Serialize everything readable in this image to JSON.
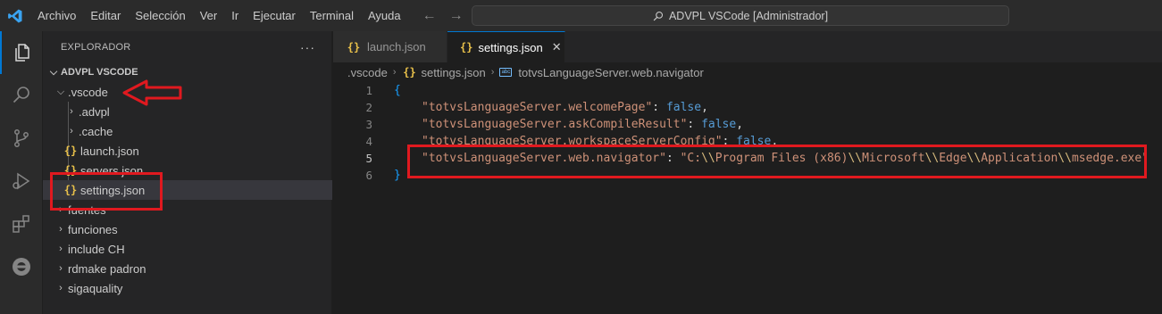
{
  "menu": [
    "Archivo",
    "Editar",
    "Selección",
    "Ver",
    "Ir",
    "Ejecutar",
    "Terminal",
    "Ayuda"
  ],
  "command_center": "ADVPL VSCode [Administrador]",
  "colors": {
    "accent": "#0078d4",
    "annotation": "#e0191f"
  },
  "sidebar": {
    "title": "EXPLORADOR",
    "more": "···",
    "tree": [
      {
        "label": "ADVPL VSCODE",
        "type": "root",
        "expanded": true
      },
      {
        "label": ".vscode",
        "type": "folder",
        "expanded": true
      },
      {
        "label": ".advpl",
        "type": "folder",
        "expanded": false
      },
      {
        "label": ".cache",
        "type": "folder",
        "expanded": false
      },
      {
        "label": "launch.json",
        "type": "json"
      },
      {
        "label": "servers.json",
        "type": "json"
      },
      {
        "label": "settings.json",
        "type": "json",
        "selected": true
      },
      {
        "label": "fuentes",
        "type": "folder",
        "expanded": false
      },
      {
        "label": "funciones",
        "type": "folder",
        "expanded": false
      },
      {
        "label": "include CH",
        "type": "folder",
        "expanded": false
      },
      {
        "label": "rdmake padron",
        "type": "folder",
        "expanded": false
      },
      {
        "label": "sigaquality",
        "type": "folder",
        "expanded": false
      }
    ]
  },
  "tabs": [
    {
      "label": "launch.json",
      "active": false
    },
    {
      "label": "settings.json",
      "active": true
    }
  ],
  "breadcrumb": [
    ".vscode",
    "settings.json",
    "totvsLanguageServer.web.navigator"
  ],
  "editor": {
    "lines": [
      {
        "n": "1",
        "text": "{"
      },
      {
        "n": "2",
        "key": "\"totvsLanguageServer.welcomePage\"",
        "sep": ": ",
        "value": "false",
        "end": ","
      },
      {
        "n": "3",
        "key": "\"totvsLanguageServer.askCompileResult\"",
        "sep": ": ",
        "value": "false",
        "end": ","
      },
      {
        "n": "4",
        "key": "\"totvsLanguageServer.workspaceServerConfig\"",
        "sep": ": ",
        "value": "false",
        "end": ","
      },
      {
        "n": "5",
        "key": "\"totvsLanguageServer.web.navigator\"",
        "sep": ": ",
        "value_parts": [
          "\"C:",
          "\\\\",
          "Program Files (x86)",
          "\\\\",
          "Microsoft",
          "\\\\",
          "Edge",
          "\\\\",
          "Application",
          "\\\\",
          "msedge.exe\""
        ]
      },
      {
        "n": "6",
        "text": "}"
      }
    ]
  }
}
